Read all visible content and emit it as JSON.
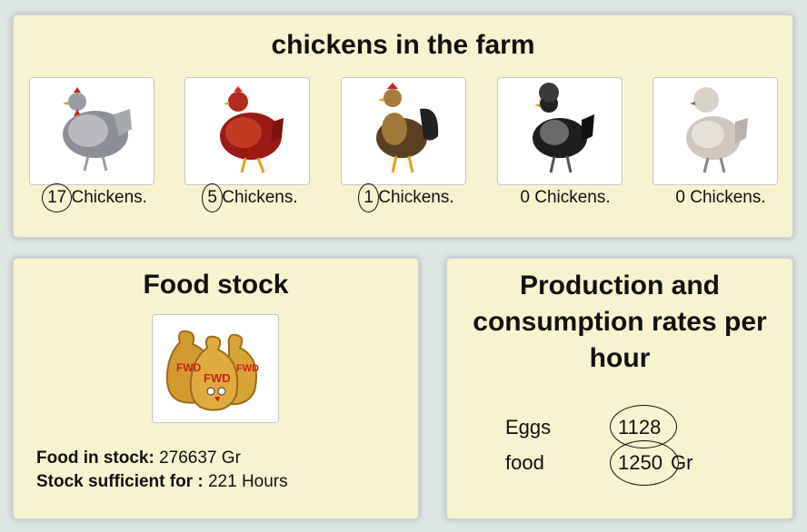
{
  "farm": {
    "title": "chickens in the farm",
    "chickens": [
      {
        "icon": "grey-hen-icon",
        "count": "17",
        "unit": "Chickens.",
        "circled": true
      },
      {
        "icon": "red-hen-icon",
        "count": "5",
        "unit": "Chickens.",
        "circled": true
      },
      {
        "icon": "rooster-icon",
        "count": "1",
        "unit": "Chickens.",
        "circled": true
      },
      {
        "icon": "black-crested-chicken-icon",
        "count": "0",
        "unit": "Chickens.",
        "circled": false
      },
      {
        "icon": "white-silkie-chicken-icon",
        "count": "0",
        "unit": "Chickens.",
        "circled": false
      }
    ]
  },
  "food": {
    "title": "Food stock",
    "icon": "feed-sacks-icon",
    "stock_label": "Food in stock:",
    "stock_value": "276637 Gr",
    "sufficient_label": "Stock sufficient for :",
    "sufficient_value": "221 Hours"
  },
  "rates": {
    "title": "Production and consumption rates per hour",
    "eggs_label": "Eggs",
    "eggs_value": "1128",
    "food_label": "food",
    "food_value": "1250",
    "food_unit": "Gr"
  },
  "colors": {
    "panel": "#f7f3cf",
    "background": "#dfe6e6"
  }
}
